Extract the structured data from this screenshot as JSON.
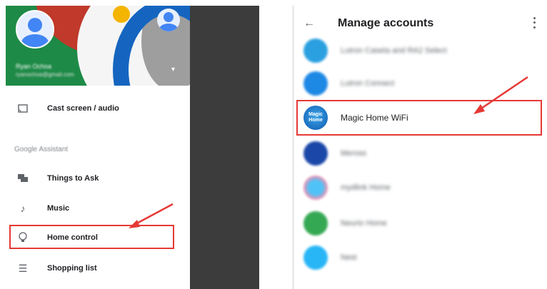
{
  "left_panel": {
    "account": {
      "name": "Ryan Ochoa",
      "email": "ryanochoa@gmail.com"
    },
    "drawer_items": [
      {
        "label": "Cast screen / audio",
        "icon": "cast-icon"
      },
      {
        "label": "Things to Ask",
        "icon": "chat-icon"
      },
      {
        "label": "Music",
        "icon": "music-note-icon"
      },
      {
        "label": "Home control",
        "icon": "lightbulb-icon"
      },
      {
        "label": "Shopping list",
        "icon": "list-icon"
      }
    ],
    "section_label": "Google Assistant"
  },
  "right_panel": {
    "title": "Manage accounts",
    "accounts": [
      {
        "label": "Lutron Caseta and RA2 Select",
        "color": "#2aa0e0"
      },
      {
        "label": "Lutron Connect",
        "color": "#1e88e5"
      },
      {
        "label": "Magic Home WiFi",
        "color": "#1b6fc1",
        "icon_text": "Magic Home"
      },
      {
        "label": "Meross",
        "color": "#1a47a8"
      },
      {
        "label": "mydlink Home",
        "color": "#4fc3f7"
      },
      {
        "label": "Neurio Home",
        "color": "#34a853"
      },
      {
        "label": "Nest",
        "color": "#29b6f6"
      }
    ]
  },
  "colors": {
    "highlight": "#e53935",
    "header_green": "#1e8a47"
  }
}
